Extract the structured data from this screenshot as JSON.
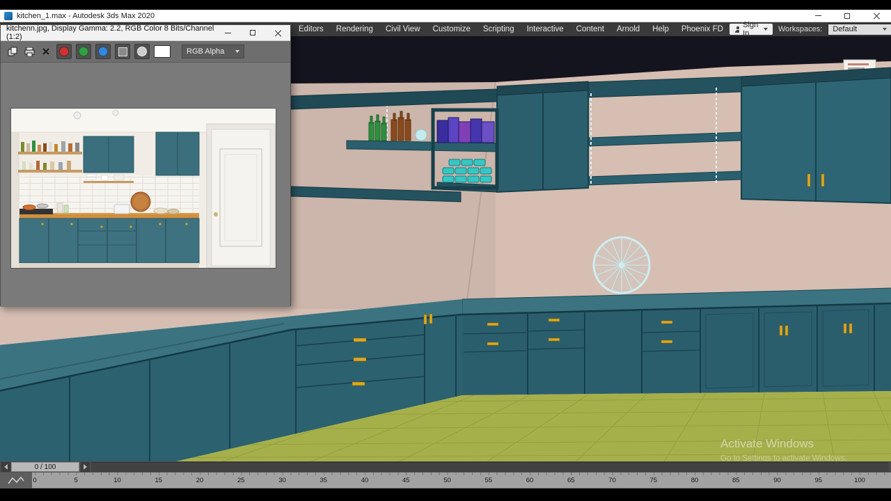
{
  "title_bar": {
    "title": "kitchen_1.max - Autodesk 3ds Max 2020"
  },
  "menu_bar": {
    "items": [
      "Editors",
      "Rendering",
      "Civil View",
      "Customize",
      "Scripting",
      "Interactive",
      "Content",
      "Arnold",
      "Help",
      "Phoenix FD"
    ],
    "sign_in_label": "Sign In",
    "workspaces_label": "Workspaces:",
    "workspace_value": "Default"
  },
  "render_window": {
    "title": "kitchenn.jpg, Display Gamma: 2.2, RGB Color 8 Bits/Channel (1:2)",
    "toolbar": {
      "icons": [
        "clone-icon",
        "print-icon",
        "clear-icon",
        "red-channel-icon",
        "green-channel-icon",
        "blue-channel-icon",
        "alpha-channel-icon",
        "monochrome-icon",
        "color-swatch"
      ],
      "channel_dropdown": "RGB Alpha"
    }
  },
  "viewport": {
    "colors": {
      "wall": "#d6beb2",
      "cabinet": "#2c6170",
      "cabinet_top": "#3b7381",
      "floor": "#a6b04b",
      "handle": "#dca81f",
      "ceiling_shadow": "#14141f",
      "chain": "#dff3f5"
    }
  },
  "timeline": {
    "frame_display": "0 / 100",
    "ticks": [
      "0",
      "5",
      "10",
      "15",
      "20",
      "25",
      "30",
      "35",
      "40",
      "45",
      "50",
      "55",
      "60",
      "65",
      "70",
      "75",
      "80",
      "85",
      "90",
      "95",
      "100"
    ]
  },
  "watermark": {
    "line1": "Activate Windows",
    "line2": "Go to Settings to activate Windows."
  }
}
